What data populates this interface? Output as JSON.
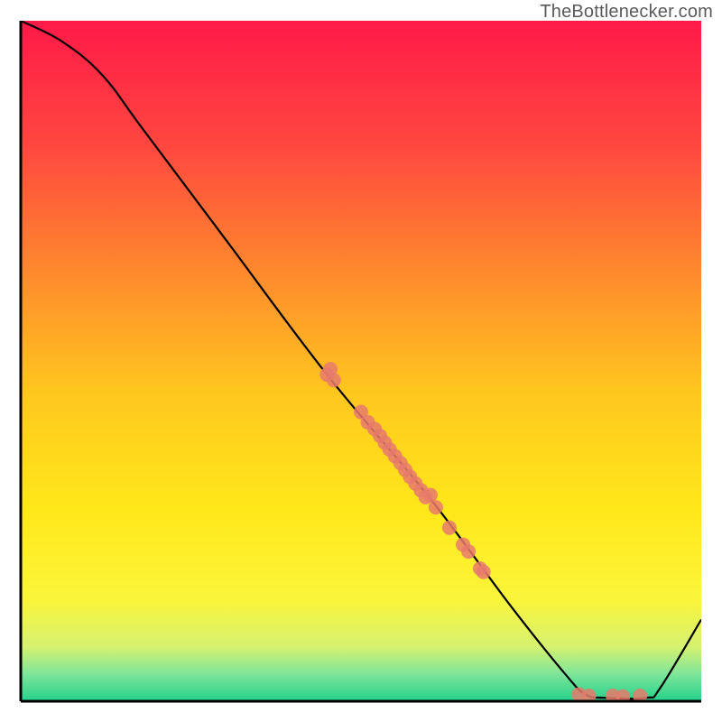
{
  "attribution": "TheBottlenecker.com",
  "colors": {
    "point": "#e77a6c",
    "curve": "#000000",
    "grad_top": "#ff1a48",
    "grad_bottom": "#23d18b"
  },
  "chart_data": {
    "type": "line",
    "title": "",
    "xlabel": "",
    "ylabel": "",
    "xlim": [
      0,
      100
    ],
    "ylim": [
      0,
      100
    ],
    "curve": [
      {
        "x": 0,
        "y": 100
      },
      {
        "x": 6,
        "y": 97
      },
      {
        "x": 12,
        "y": 92
      },
      {
        "x": 18,
        "y": 84
      },
      {
        "x": 30,
        "y": 68
      },
      {
        "x": 45,
        "y": 48
      },
      {
        "x": 60,
        "y": 30
      },
      {
        "x": 72,
        "y": 14
      },
      {
        "x": 80,
        "y": 4
      },
      {
        "x": 83,
        "y": 1
      },
      {
        "x": 86,
        "y": 0.5
      },
      {
        "x": 92,
        "y": 0.5
      },
      {
        "x": 94,
        "y": 2
      },
      {
        "x": 100,
        "y": 12
      }
    ],
    "points": [
      {
        "x": 45.0,
        "y": 48.0
      },
      {
        "x": 45.5,
        "y": 48.8
      },
      {
        "x": 46.0,
        "y": 47.2
      },
      {
        "x": 50.0,
        "y": 42.5
      },
      {
        "x": 51.0,
        "y": 41.0
      },
      {
        "x": 52.0,
        "y": 40.0
      },
      {
        "x": 52.8,
        "y": 39.0
      },
      {
        "x": 53.5,
        "y": 38.0
      },
      {
        "x": 54.2,
        "y": 37.0
      },
      {
        "x": 55.0,
        "y": 36.0
      },
      {
        "x": 55.8,
        "y": 35.0
      },
      {
        "x": 56.5,
        "y": 34.0
      },
      {
        "x": 57.2,
        "y": 33.0
      },
      {
        "x": 58.0,
        "y": 32.0
      },
      {
        "x": 58.8,
        "y": 31.0
      },
      {
        "x": 59.5,
        "y": 30.0
      },
      {
        "x": 60.2,
        "y": 30.3
      },
      {
        "x": 61.0,
        "y": 28.5
      },
      {
        "x": 63.0,
        "y": 25.5
      },
      {
        "x": 65.0,
        "y": 23.0
      },
      {
        "x": 65.8,
        "y": 22.0
      },
      {
        "x": 67.5,
        "y": 19.5
      },
      {
        "x": 68.0,
        "y": 19.0
      },
      {
        "x": 82.0,
        "y": 1.0
      },
      {
        "x": 83.5,
        "y": 0.8
      },
      {
        "x": 87.0,
        "y": 0.8
      },
      {
        "x": 88.5,
        "y": 0.7
      },
      {
        "x": 91.0,
        "y": 0.8
      }
    ]
  },
  "computed": {
    "curve_d": ""
  }
}
